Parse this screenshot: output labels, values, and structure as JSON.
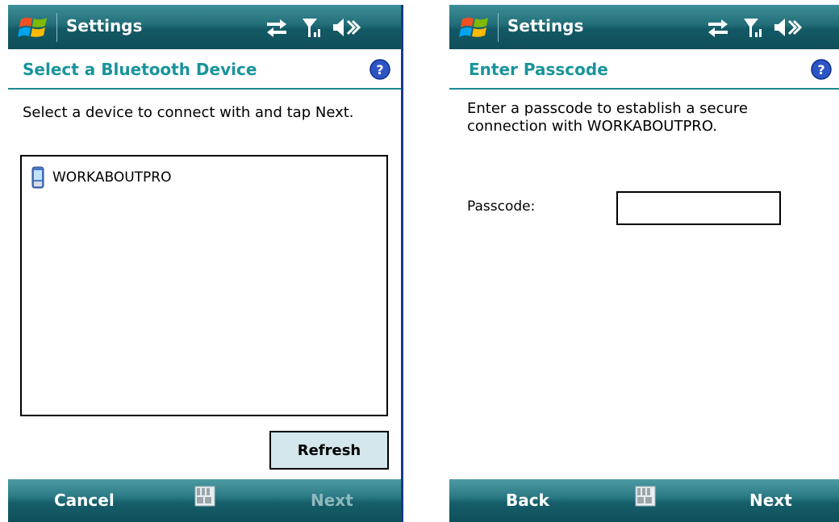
{
  "left": {
    "title": "Settings",
    "header": "Select a Bluetooth Device",
    "instruction": "Select a device to connect with and tap Next.",
    "devices": [
      {
        "name": "WORKABOUTPRO",
        "icon": "phone-icon"
      }
    ],
    "refresh_label": "Refresh",
    "softkey_left": "Cancel",
    "softkey_right": "Next",
    "softkey_right_enabled": false
  },
  "right": {
    "title": "Settings",
    "header": "Enter Passcode",
    "instruction_line1": "Enter a passcode to establish a secure",
    "instruction_line2": "connection with WORKABOUTPRO.",
    "passcode_label": "Passcode:",
    "passcode_value": "",
    "softkey_left": "Back",
    "softkey_right": "Next",
    "softkey_right_enabled": true
  },
  "icons": [
    "windows-start-icon",
    "connectivity-icon",
    "signal-icon",
    "volume-muted-icon",
    "help-icon",
    "keyboard-icon"
  ],
  "colors": {
    "header_text": "#19949c",
    "titlebar": "#1f6b76",
    "disabled_text": "#8fb8bd",
    "refresh_bg": "#d3e7ec"
  }
}
